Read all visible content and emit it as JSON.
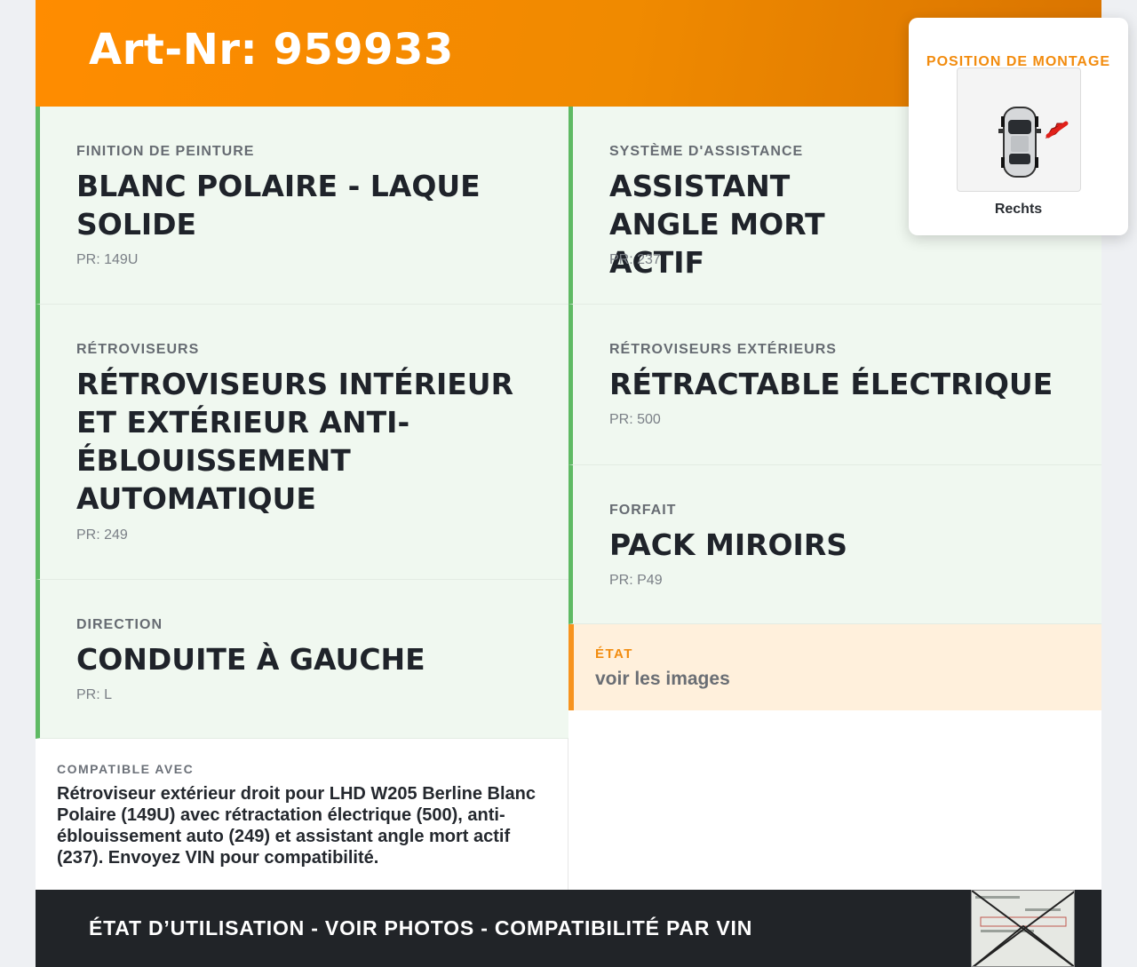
{
  "header": {
    "title": "Art-Nr: 959933"
  },
  "mount_position": {
    "title": "POSITION DE MONTAGE",
    "side": "Rechts"
  },
  "left_cells": [
    {
      "label": "FINITION DE PEINTURE",
      "value": "BLANC POLAIRE - LAQUE SOLIDE",
      "pr": "PR: 149U"
    },
    {
      "label": "RÉTROVISEURS",
      "value": "RÉTROVISEURS INTÉRIEUR ET EXTÉRIEUR ANTI-ÉBLOUISSEMENT AUTOMATIQUE",
      "pr": "PR: 249"
    },
    {
      "label": "DIRECTION",
      "value": "CONDUITE À GAUCHE",
      "pr": "PR: L"
    }
  ],
  "right_cells": [
    {
      "label": "SYSTÈME D'ASSISTANCE",
      "value": "ASSISTANT ANGLE MORT ACTIF",
      "pr": "PR: 237"
    },
    {
      "label": "RÉTROVISEURS EXTÉRIEURS",
      "value": "RÉTRACTABLE ÉLECTRIQUE",
      "pr": "PR: 500"
    },
    {
      "label": "FORFAIT",
      "value": "PACK MIROIRS",
      "pr": "PR: P49"
    }
  ],
  "etat": {
    "label": "ÉTAT",
    "text": "voir les images"
  },
  "compat": {
    "label": "COMPATIBLE AVEC",
    "text": "Rétroviseur extérieur droit pour LHD W205 Berline Blanc Polaire (149U) avec rétractation électrique (500), anti-éblouissement auto (249) et assistant angle mort actif (237). Envoyez VIN pour compatibilité."
  },
  "footer": {
    "text": "ÉTAT D’UTILISATION - VOIR PHOTOS - COMPATIBILITÉ PAR VIN"
  },
  "colors": {
    "accent_orange": "#ff8c00",
    "green_bar": "#5fba64",
    "footer_bg": "#212428"
  },
  "icons": {
    "car": "car-top-view-icon",
    "arrow": "red-arrow-icon",
    "document": "document-thumbnail-icon"
  }
}
